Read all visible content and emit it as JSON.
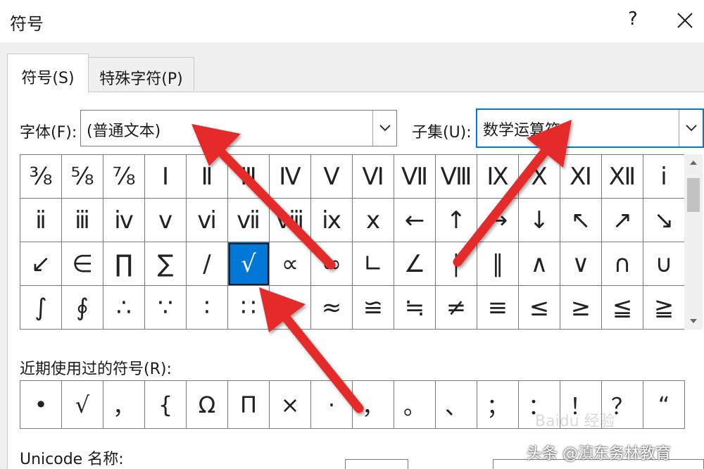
{
  "dialog": {
    "title": "符号",
    "help_label": "?"
  },
  "tabs": [
    {
      "label": "符号(S)",
      "active": true
    },
    {
      "label": "特殊字符(P)",
      "active": false
    }
  ],
  "font": {
    "label": "字体(F):",
    "value": "(普通文本)"
  },
  "subset": {
    "label": "子集(U):",
    "value": "数学运算符"
  },
  "symbol_grid": {
    "rows": [
      [
        "⅜",
        "⅝",
        "⅞",
        "Ⅰ",
        "Ⅱ",
        "Ⅲ",
        "Ⅳ",
        "Ⅴ",
        "Ⅵ",
        "Ⅶ",
        "Ⅷ",
        "Ⅸ",
        "Ⅹ",
        "Ⅺ",
        "Ⅻ",
        "ⅰ"
      ],
      [
        "ⅱ",
        "ⅲ",
        "ⅳ",
        "ⅴ",
        "ⅵ",
        "ⅶ",
        "ⅷ",
        "ⅸ",
        "ⅹ",
        "←",
        "↑",
        "→",
        "↓",
        "↖",
        "↗",
        "↘"
      ],
      [
        "↙",
        "∈",
        "∏",
        "∑",
        "∕",
        "√",
        "∝",
        "∞",
        "∟",
        "∠",
        "∣",
        "∥",
        "∧",
        "∨",
        "∩",
        "∪"
      ],
      [
        "∫",
        "∮",
        "∴",
        "∵",
        "∶",
        "∷",
        "∽",
        "≈",
        "≌",
        "≒",
        "≠",
        "≡",
        "≤",
        "≥",
        "≦",
        "≧"
      ]
    ],
    "selected": "√"
  },
  "recent": {
    "label": "近期使用过的符号(R):",
    "symbols": [
      "•",
      "√",
      "，",
      "{",
      "Ω",
      "Π",
      "×",
      "·",
      "，",
      "。",
      "、",
      "；",
      "：",
      "！",
      "？",
      "“"
    ]
  },
  "unicode": {
    "label": "Unicode 名称:"
  },
  "watermark": {
    "brand": "头条 @滇东务林教育",
    "faint": "Baidu 经验"
  },
  "colors": {
    "selection": "#0078d7",
    "annotation_arrow": "#e52a2a"
  }
}
